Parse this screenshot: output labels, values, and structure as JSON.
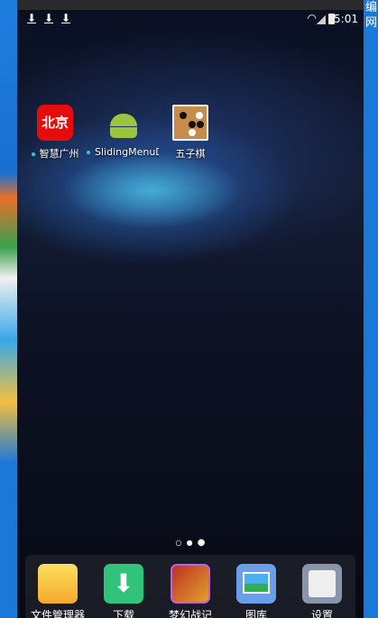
{
  "desktop": {
    "right_text": [
      "编",
      "网"
    ]
  },
  "statusbar": {
    "time": "5:01",
    "notifications": [
      "download-icon",
      "download-icon",
      "download-icon"
    ]
  },
  "home_apps": [
    {
      "label": "智慧广州",
      "icon_text": "北京",
      "new": true
    },
    {
      "label": "SlidingMenuDe",
      "new": true
    },
    {
      "label": "五子棋",
      "new": false
    }
  ],
  "pager": {
    "pages": 3,
    "current": 3
  },
  "dock": [
    {
      "label": "文件管理器",
      "color": "#f5b52a"
    },
    {
      "label": "下载",
      "color": "#2fc47a"
    },
    {
      "label": "梦幻战记",
      "color": "#b83a2a"
    },
    {
      "label": "图库",
      "color": "#6a9ee8"
    },
    {
      "label": "设置",
      "color": "#8a94aa"
    }
  ]
}
